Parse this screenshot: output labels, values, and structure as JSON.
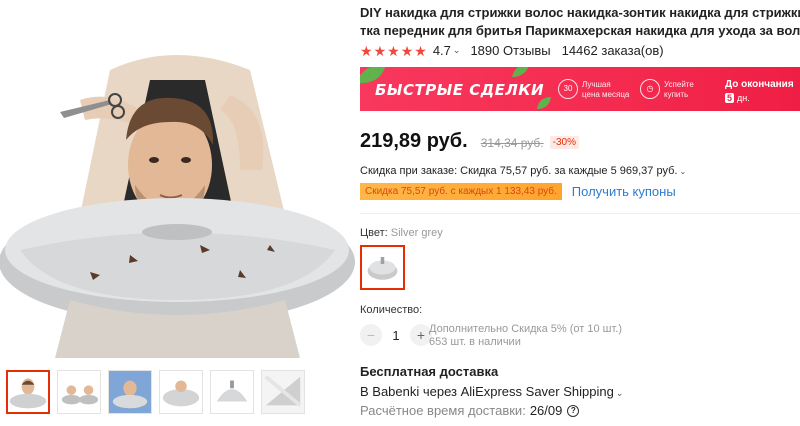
{
  "product": {
    "title_lines": [
      "DIY накидка для стрижки волос накидка-зонтик накидка для стрижки волос обер",
      "тка передник для бритья Парикмахерская накидка для ухода за волосами"
    ]
  },
  "rating": {
    "stars": 5,
    "value": "4.7",
    "reviews": "1890 Отзывы",
    "orders": "14462 заказа(ов)"
  },
  "deals_banner": {
    "title": "БЫСТРЫЕ СДЕЛКИ",
    "badge1_icon": "30",
    "badge1_text_l1": "Лучшая",
    "badge1_text_l2": "цена месяца",
    "badge2_text_l1": "Успейте",
    "badge2_text_l2": "купить",
    "ends_label": "До окончания",
    "days_value": "5",
    "days_unit": "дн."
  },
  "price": {
    "current": "219,89 руб.",
    "old": "314,34 руб.",
    "discount": "-30%"
  },
  "order_discount": "Скидка при заказе: Скидка 75,57 руб. за каждые 5 969,37 руб.",
  "coupon": {
    "tag": "Скидка 75,57 руб. с каждых 1 133,43 руб.",
    "link": "Получить купоны"
  },
  "color": {
    "label": "Цвет:",
    "value": "Silver grey"
  },
  "quantity": {
    "label": "Количество:",
    "value": "1",
    "minus": "−",
    "plus": "+",
    "note1": "Дополнительно Скидка 5% (от 10 шт.)",
    "note2": "653 шт. в наличии"
  },
  "shipping": {
    "title": "Бесплатная доставка",
    "method": "В Babenki через AliExpress Saver Shipping",
    "time_label": "Расчётное время доставки:",
    "time_value": "26/09",
    "help": "?"
  },
  "colors": {
    "accent": "#e62e04",
    "banner": "#f42a4f",
    "link": "#2e7ccf",
    "star": "#f2473a"
  }
}
